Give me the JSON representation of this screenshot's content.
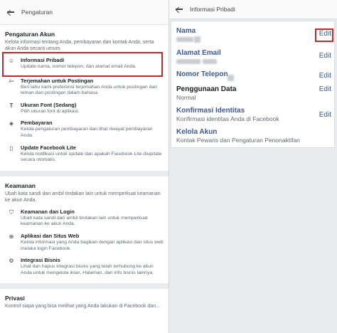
{
  "left": {
    "header_title": "Pengaturan",
    "sections": {
      "account": {
        "title": "Pengaturan Akun",
        "desc": "Kelola informasi tentang Anda, pembayaran dan kontak Anda, serta akun Anda secara umum.",
        "items": [
          {
            "title": "Informasi Pribadi",
            "desc": "Update nama, nomor telepon, dan alamat email Anda.",
            "icon": "person-icon"
          },
          {
            "title": "Terjemahan untuk Postingan",
            "desc": "Beri tahu kami preferensi terjemahan Anda untuk postingan dari teman dan postingan dalam bahasa.",
            "icon": "translate-icon"
          },
          {
            "title": "Ukuran Font (Sedang)",
            "desc": "Pilih ukuran font di aplikasi.",
            "icon": "font-size-icon"
          },
          {
            "title": "Pembayaran",
            "desc": "Kelola pengaturan pembayaran dan lihat riwayat pembayaran Anda.",
            "icon": "tag-icon"
          },
          {
            "title": "Update Facebook Lite",
            "desc": "Kelola notifikasi untuk update dan apakah Facebook Lite diupdate secara otomatis.",
            "icon": "phone-icon"
          }
        ]
      },
      "security": {
        "title": "Keamanan",
        "desc": "Ubah kata sandi dan ambil tindakan lain untuk memperkuat keamanan ke akun Anda.",
        "items": [
          {
            "title": "Keamanan dan Login",
            "desc": "Ubah kata sandi dan ambil tindakan lain untuk memperkuat keamanan ke akun Anda.",
            "icon": "shield-icon"
          },
          {
            "title": "Aplikasi dan Situs Web",
            "desc": "Kelola informasi yang Anda bagikan dengan aplikasi dan situs web melalui login Facebook",
            "icon": "apps-icon"
          },
          {
            "title": "Integrasi Bisnis",
            "desc": "Lihat dan hapus integrasi bisnis yang telah terhubung ke akun Anda untuk mengelola iklan, Halaman, dan info bisnis lainnya.",
            "icon": "integration-icon"
          }
        ]
      },
      "privacy": {
        "title": "Privasi",
        "desc": "Kontrol siapa yang bisa melihat yang Anda lakukan di Facebook dan..."
      }
    }
  },
  "right": {
    "header_title": "Informasi Pribadi",
    "fields": [
      {
        "label": "Nama",
        "value": "",
        "edit": "Edit"
      },
      {
        "label": "Alamat Email",
        "value": "",
        "edit": "Edit"
      },
      {
        "label": "Nomor Telepon",
        "value": "",
        "edit": "Edit"
      },
      {
        "label": "Penggunaan Data",
        "value": "Normal",
        "edit": "Edit"
      },
      {
        "label": "Konfirmasi Identitas",
        "value": "Konfirmasi identitas Anda di Facebook",
        "edit": "Edit"
      },
      {
        "label": "Kelola Akun",
        "value": "Kontak Pewaris dan Pengaturan Penonaktifan",
        "edit": ""
      }
    ]
  },
  "colors": {
    "link": "#3b5998",
    "highlight": "#c62828"
  }
}
